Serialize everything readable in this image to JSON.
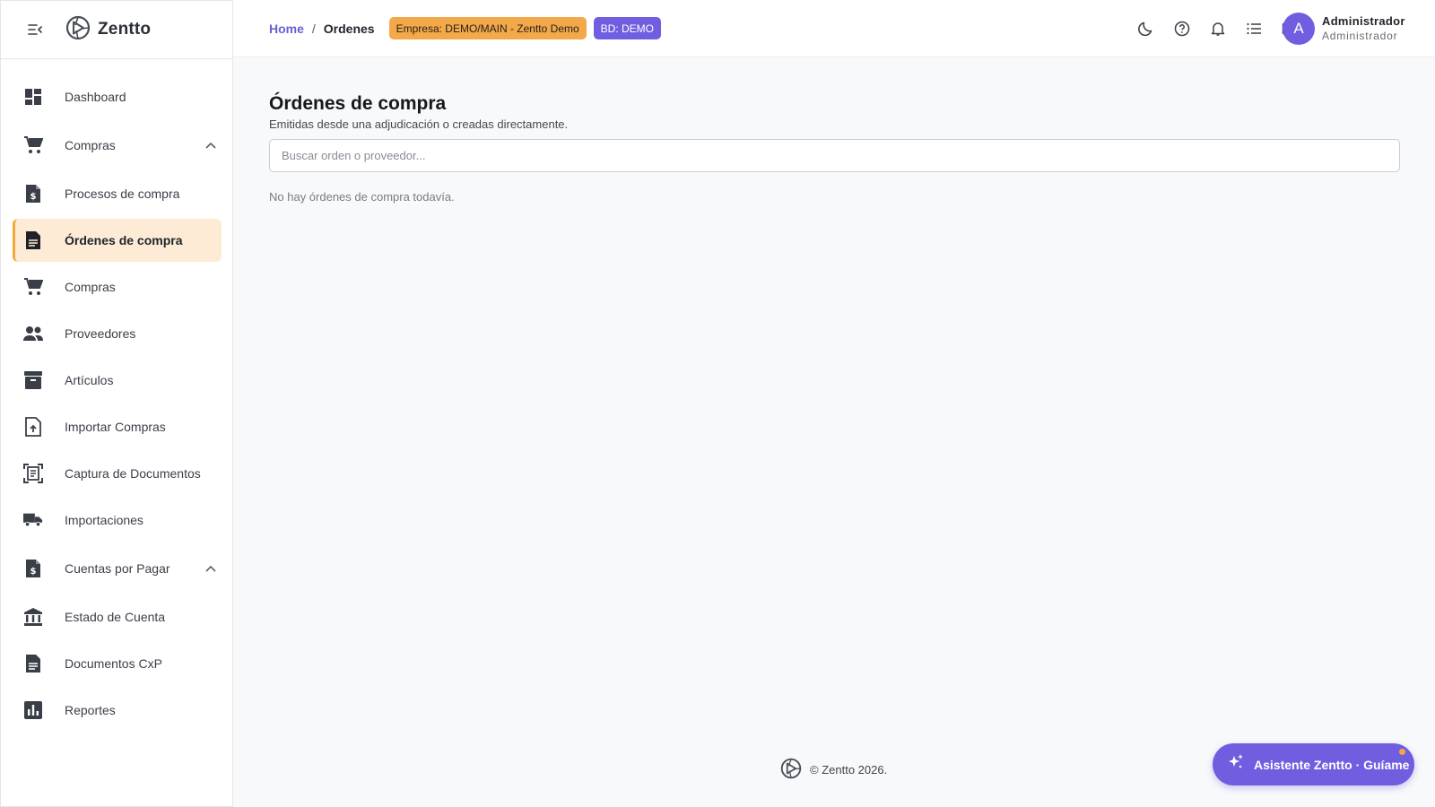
{
  "app": {
    "brand": "Zentto"
  },
  "breadcrumb": {
    "home": "Home",
    "separator": "/",
    "current": "Ordenes"
  },
  "badges": {
    "company": "Empresa: DEMO/MAIN - Zentto Demo",
    "database": "BD: DEMO"
  },
  "topbar": {
    "icons": [
      "moon-icon",
      "help-icon",
      "bell-icon",
      "list-icon",
      "mail-icon"
    ]
  },
  "user": {
    "initial": "A",
    "name": "Administrador",
    "role": "Administrador"
  },
  "sidebar": {
    "items": [
      {
        "label": "Dashboard",
        "icon": "dashboard-icon"
      },
      {
        "label": "Compras",
        "icon": "cart-icon",
        "expanded": true
      },
      {
        "label": "Procesos de compra",
        "icon": "invoice-dollar-icon"
      },
      {
        "label": "Órdenes de compra",
        "icon": "document-icon",
        "active": true
      },
      {
        "label": "Compras",
        "icon": "cart-icon"
      },
      {
        "label": "Proveedores",
        "icon": "people-icon"
      },
      {
        "label": "Artículos",
        "icon": "archive-icon"
      },
      {
        "label": "Importar Compras",
        "icon": "upload-file-icon"
      },
      {
        "label": "Captura de Documentos",
        "icon": "document-scanner-icon"
      },
      {
        "label": "Importaciones",
        "icon": "truck-icon"
      },
      {
        "label": "Cuentas por Pagar",
        "icon": "invoice-dollar-icon",
        "expanded": true
      },
      {
        "label": "Estado de Cuenta",
        "icon": "bank-icon"
      },
      {
        "label": "Documentos CxP",
        "icon": "document-icon"
      },
      {
        "label": "Reportes",
        "icon": "bar-chart-icon"
      }
    ]
  },
  "page": {
    "title": "Órdenes de compra",
    "subtitle": "Emitidas desde una adjudicación o creadas directamente.",
    "search_placeholder": "Buscar orden o proveedor...",
    "empty_message": "No hay órdenes de compra todavía."
  },
  "footer": {
    "copyright": "© Zentto 2026."
  },
  "assistant": {
    "label": "Asistente Zentto · Guíame"
  },
  "colors": {
    "accent": "#6f5fe0",
    "company_badge": "#f3a84a",
    "active_item_bg": "#fdebd6",
    "active_item_border": "#f5a73b"
  }
}
